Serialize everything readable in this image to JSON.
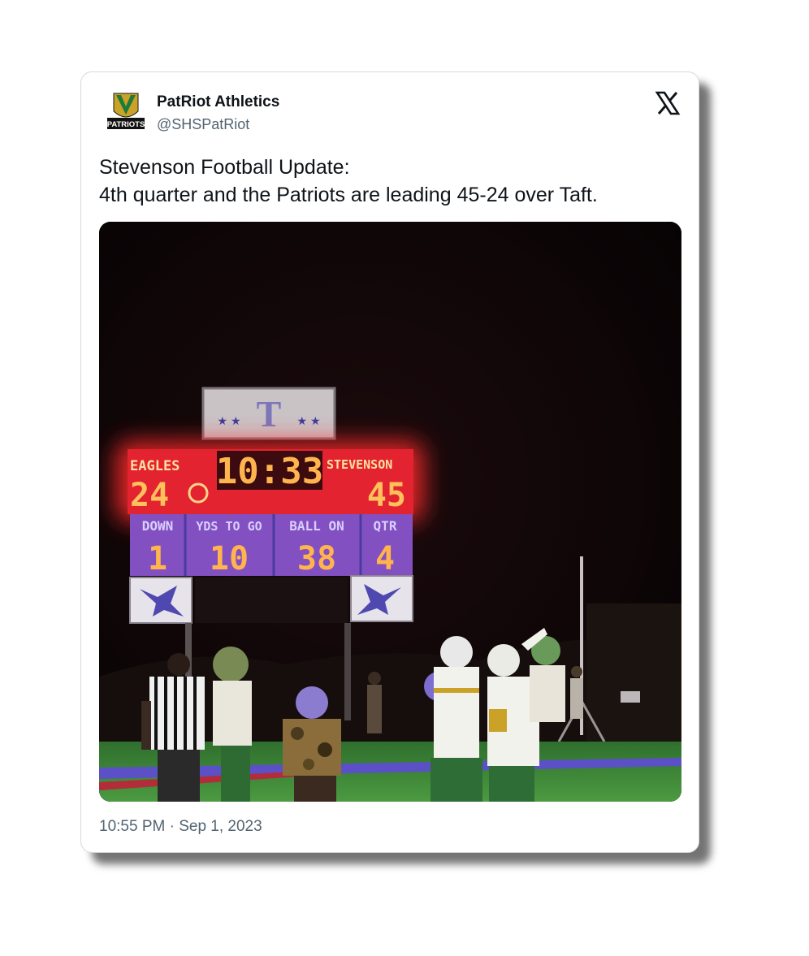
{
  "author": {
    "display_name": "PatRiot Athletics",
    "handle": "@SHSPatRiot",
    "avatar_text": "PATRIOTS"
  },
  "platform_icon": "x-logo-icon",
  "tweet": {
    "line1": "Stevenson Football Update:",
    "line2": "4th quarter and the Patriots are leading 45-24 over Taft."
  },
  "timestamp": "10:55 PM · Sep 1, 2023",
  "scoreboard": {
    "home_label": "EAGLES",
    "home_score": "24",
    "clock": "10:33",
    "guest_label": "STEVENSON",
    "guest_score": "45",
    "down_label": "DOWN",
    "down_value": "1",
    "ytg_label": "YDS TO GO",
    "ytg_value": "10",
    "ballon_label": "BALL ON",
    "ballon_value": "38",
    "qtr_label": "QTR",
    "qtr_value": "4"
  },
  "colors": {
    "text_primary": "#0f1419",
    "text_secondary": "#536471",
    "led": "#ffb04a",
    "scoreboard_red": "#e8202c",
    "field_green": "#3f8a3a"
  }
}
